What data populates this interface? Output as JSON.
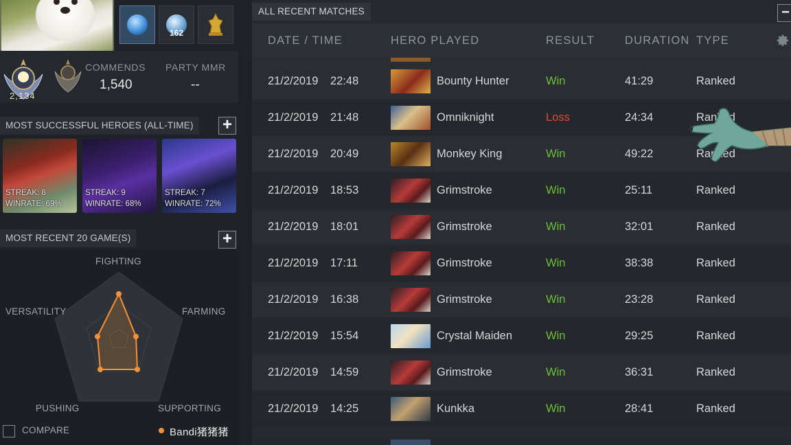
{
  "profile": {
    "commends_label": "COMMENDS",
    "commends_value": "1,540",
    "party_mmr_label": "PARTY MMR",
    "party_mmr_value": "--",
    "rank_number": "2,134",
    "trophy_badge": "162"
  },
  "heroes_section": {
    "title": "MOST SUCCESSFUL HEROES (ALL-TIME)",
    "add_label": "+",
    "cards": [
      {
        "streak": "STREAK: 8",
        "winrate": "WINRATE: 69%"
      },
      {
        "streak": "STREAK: 9",
        "winrate": "WINRATE: 68%"
      },
      {
        "streak": "STREAK: 7",
        "winrate": "WINRATE: 72%"
      }
    ]
  },
  "recent_section": {
    "title": "MOST RECENT 20 GAME(S)",
    "add_label": "+",
    "axes": {
      "fighting": "FIGHTING",
      "farming": "FARMING",
      "supporting": "SUPPORTING",
      "pushing": "PUSHING",
      "versatility": "VERSATILITY"
    },
    "compare_label": "COMPARE",
    "legend_name": "Bandi猪猪猪"
  },
  "matches": {
    "tab_label": "ALL RECENT MATCHES",
    "collapse_label": "−",
    "headers": {
      "date": "DATE / TIME",
      "hero": "HERO PLAYED",
      "result": "RESULT",
      "duration": "DURATION",
      "type": "TYPE"
    },
    "rows": [
      {
        "date": "21/2/2019",
        "time": "22:48",
        "hero": "Bounty Hunter",
        "result": "Win",
        "duration": "41:29",
        "type": "Ranked"
      },
      {
        "date": "21/2/2019",
        "time": "21:48",
        "hero": "Omniknight",
        "result": "Loss",
        "duration": "24:34",
        "type": "Ranked"
      },
      {
        "date": "21/2/2019",
        "time": "20:49",
        "hero": "Monkey King",
        "result": "Win",
        "duration": "49:22",
        "type": "Ranked"
      },
      {
        "date": "21/2/2019",
        "time": "18:53",
        "hero": "Grimstroke",
        "result": "Win",
        "duration": "25:11",
        "type": "Ranked"
      },
      {
        "date": "21/2/2019",
        "time": "18:01",
        "hero": "Grimstroke",
        "result": "Win",
        "duration": "32:01",
        "type": "Ranked"
      },
      {
        "date": "21/2/2019",
        "time": "17:11",
        "hero": "Grimstroke",
        "result": "Win",
        "duration": "38:38",
        "type": "Ranked"
      },
      {
        "date": "21/2/2019",
        "time": "16:38",
        "hero": "Grimstroke",
        "result": "Win",
        "duration": "23:28",
        "type": "Ranked"
      },
      {
        "date": "21/2/2019",
        "time": "15:54",
        "hero": "Crystal Maiden",
        "result": "Win",
        "duration": "29:25",
        "type": "Ranked"
      },
      {
        "date": "21/2/2019",
        "time": "14:59",
        "hero": "Grimstroke",
        "result": "Win",
        "duration": "36:31",
        "type": "Ranked"
      },
      {
        "date": "21/2/2019",
        "time": "14:25",
        "hero": "Kunkka",
        "result": "Win",
        "duration": "28:41",
        "type": "Ranked"
      }
    ]
  },
  "colors": {
    "win": "#6fbf3a",
    "loss": "#e04a3c",
    "radar_line": "#f3923a"
  },
  "icons": [
    "gear-icon",
    "plus-icon",
    "minus-icon",
    "rank-medal-icon",
    "trophy-icon",
    "checkbox-icon"
  ]
}
